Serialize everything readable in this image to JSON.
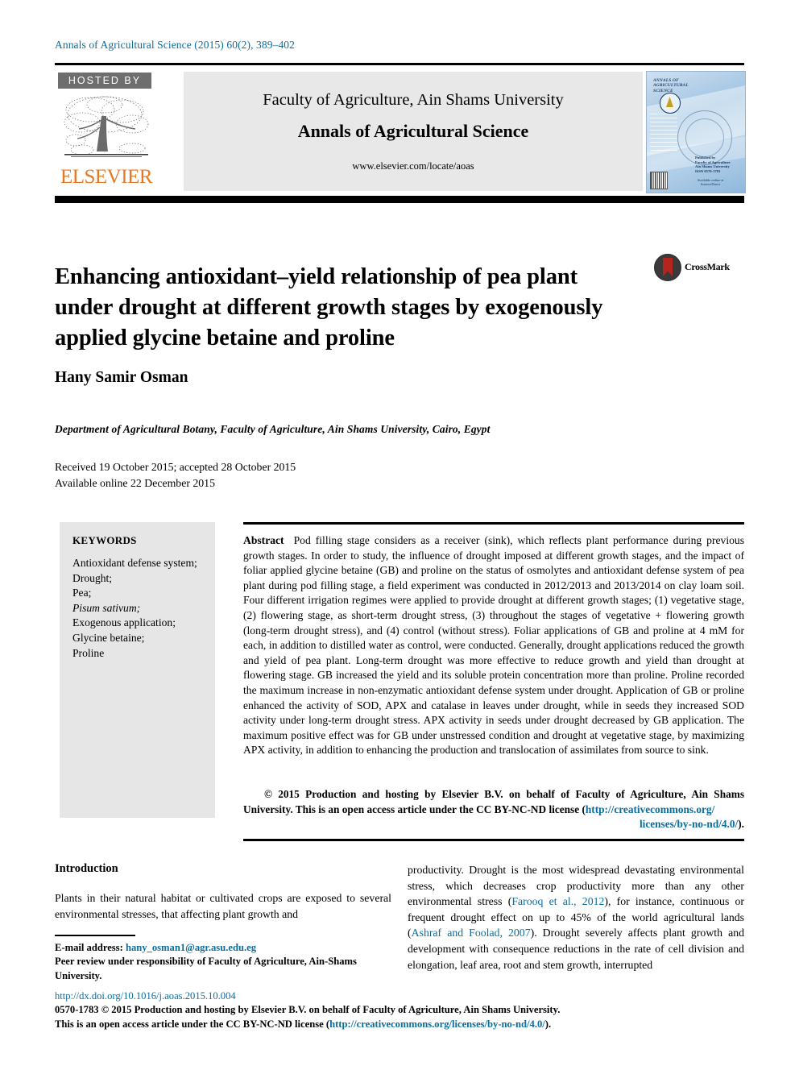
{
  "running_head": "Annals of Agricultural Science (2015) 60(2), 389–402",
  "header": {
    "hosted_by": "HOSTED BY",
    "publisher": "ELSEVIER",
    "faculty_line": "Faculty of Agriculture, Ain Shams University",
    "journal_name": "Annals of Agricultural Science",
    "journal_url": "www.elsevier.com/locate/aoas",
    "cover": {
      "title_lines": "ANNALS OF\nAGRICULTURAL\nSCIENCE",
      "publisher_text": "Published by\nFaculty of Agriculture\nAin Shams University\nISSN 0570-1783",
      "bottom_text": "Available online at\nScienceDirect"
    }
  },
  "article": {
    "title": "Enhancing antioxidant–yield relationship of pea plant under drought at different growth stages by exogenously applied glycine betaine and proline",
    "crossmark_label": "CrossMark",
    "author": "Hany Samir Osman",
    "affiliation": "Department of Agricultural Botany, Faculty of Agriculture, Ain Shams University, Cairo, Egypt",
    "received": "Received 19 October 2015; accepted 28 October 2015",
    "available_online": "Available online 22 December 2015"
  },
  "keywords": {
    "heading": "KEYWORDS",
    "items": [
      "Antioxidant defense system;",
      "Drought;",
      "Pea;",
      "Pisum sativum;",
      "Exogenous application;",
      "Glycine betaine;",
      "Proline"
    ],
    "italic_index": 3
  },
  "abstract": {
    "label": "Abstract",
    "text": "Pod filling stage considers as a receiver (sink), which reflects plant performance during previous growth stages. In order to study, the influence of drought imposed at different growth stages, and the impact of foliar applied glycine betaine (GB) and proline on the status of osmolytes and antioxidant defense system of pea plant during pod filling stage, a field experiment was conducted in 2012/2013 and 2013/2014 on clay loam soil. Four different irrigation regimes were applied to provide drought at different growth stages; (1) vegetative stage, (2) flowering stage, as short-term drought stress, (3) throughout the stages of vegetative + flowering growth (long-term drought stress), and (4) control (without stress). Foliar applications of GB and proline at 4 mM for each, in addition to distilled water as control, were conducted. Generally, drought applications reduced the growth and yield of pea plant. Long-term drought was more effective to reduce growth and yield than drought at flowering stage. GB increased the yield and its soluble protein concentration more than proline. Proline recorded the maximum increase in non-enzymatic antioxidant defense system under drought. Application of GB or proline enhanced the activity of SOD, APX and catalase in leaves under drought, while in seeds they increased SOD activity under long-term drought stress. APX activity in seeds under drought decreased by GB application. The maximum positive effect was for GB under unstressed condition and drought at vegetative stage, by maximizing APX activity, in addition to enhancing the production and translocation of assimilates from source to sink.",
    "copyright_part1": "© 2015 Production and hosting by Elsevier B.V. on behalf of Faculty of Agriculture, Ain Shams University. This is an open access article under the CC BY-NC-ND license (",
    "copyright_link1": "http://creativecommons.org/",
    "copyright_link2": "licenses/by-no-nd/4.0/",
    "copyright_part2": ")."
  },
  "introduction": {
    "heading": "Introduction",
    "left_text": "Plants in their natural habitat or cultivated crops are exposed to several environmental stresses, that affecting plant growth and",
    "right_part1": "productivity. Drought is the most widespread devastating environmental stress, which decreases crop productivity more than any other environmental stress (",
    "right_cite1": "Farooq et al., 2012",
    "right_part2": "), for instance, continuous or frequent drought effect on up to 45% of the world agricultural lands (",
    "right_cite2": "Ashraf and Foolad, 2007",
    "right_part3": "). Drought severely affects plant growth and development with consequence reductions in the rate of cell division and elongation, leaf area, root and stem growth, interrupted"
  },
  "footnotes": {
    "email_label": "E-mail address:",
    "email": "hany_osman1@agr.asu.edu.eg",
    "peer_review": "Peer review under responsibility of Faculty of Agriculture, Ain-Shams University."
  },
  "footer": {
    "doi": "http://dx.doi.org/10.1016/j.aoas.2015.10.004",
    "line1": "0570-1783 © 2015 Production and hosting by Elsevier B.V. on behalf of Faculty of Agriculture, Ain Shams University.",
    "line2_pre": "This is an open access article under the CC BY-NC-ND license (",
    "line2_link": "http://creativecommons.org/licenses/by-no-nd/4.0/",
    "line2_post": ")."
  },
  "colors": {
    "link": "#0b6d9e",
    "elsevier_orange": "#E87722",
    "hosted_gray": "#6e6e6e",
    "box_gray": "#e6e6e6"
  }
}
